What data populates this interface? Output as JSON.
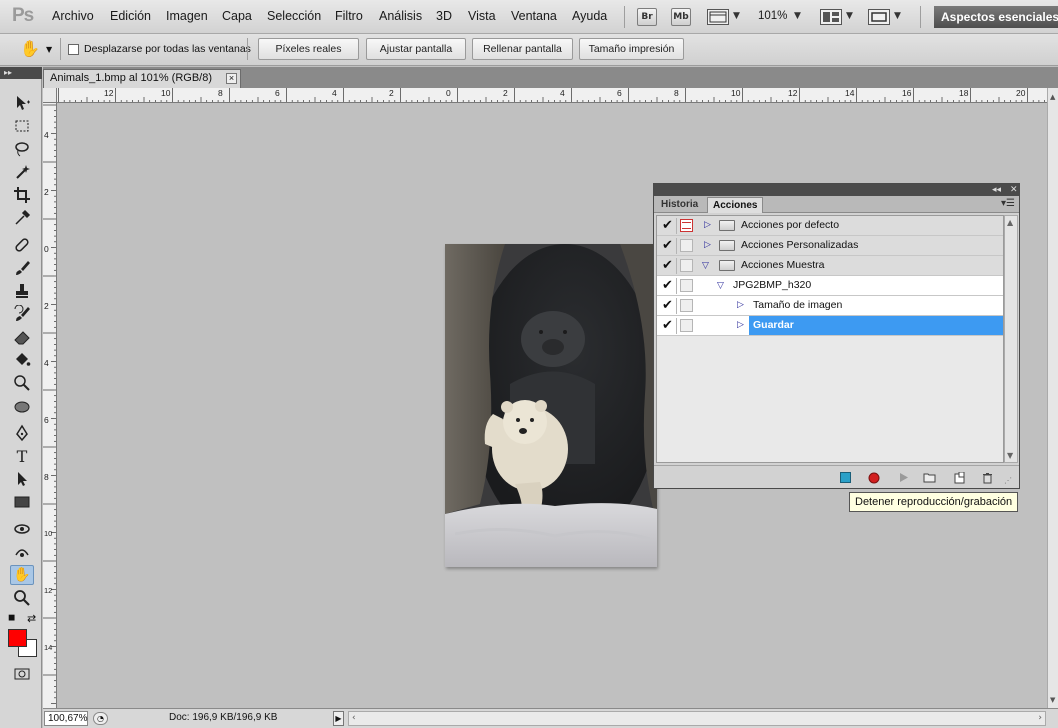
{
  "app": {
    "logo": "Ps"
  },
  "menu": {
    "items": [
      "Archivo",
      "Edición",
      "Imagen",
      "Capa",
      "Selección",
      "Filtro",
      "Análisis",
      "3D",
      "Vista",
      "Ventana",
      "Ayuda"
    ],
    "bridge_label": "Br",
    "minibridge_label": "Mb",
    "zoom": "101%",
    "workspace": "Aspectos esenciales"
  },
  "options": {
    "scroll_all_label": "Desplazarse por todas las ventanas",
    "scroll_all_checked": false,
    "buttons": [
      "Píxeles reales",
      "Ajustar pantalla",
      "Rellenar pantalla",
      "Tamaño impresión"
    ]
  },
  "document": {
    "tab_title": "Animals_1.bmp al 101% (RGB/8)",
    "ruler_top": [
      "12",
      "10",
      "8",
      "6",
      "4",
      "2",
      "0",
      "2",
      "4",
      "6",
      "8",
      "10",
      "12",
      "14",
      "16",
      "18",
      "20"
    ],
    "ruler_left": [
      "4",
      "2",
      "0",
      "2",
      "4",
      "6",
      "8",
      "10",
      "12",
      "14"
    ]
  },
  "status": {
    "zoom": "100,67%",
    "doc_info": "Doc: 196,9 KB/196,9 KB"
  },
  "actions_panel": {
    "tabs": [
      "Historia",
      "Acciones"
    ],
    "active_tab": "Acciones",
    "rows": [
      {
        "label": "Acciones por defecto",
        "kind": "set",
        "expanded": false,
        "checked": true,
        "dialog": "on"
      },
      {
        "label": "Acciones Personalizadas",
        "kind": "set",
        "expanded": false,
        "checked": true,
        "dialog": "off"
      },
      {
        "label": "Acciones Muestra",
        "kind": "set",
        "expanded": true,
        "checked": true,
        "dialog": "off"
      },
      {
        "label": "JPG2BMP_h320",
        "kind": "action",
        "expanded": true,
        "checked": true,
        "dialog": "off"
      },
      {
        "label": "Tamaño de imagen",
        "kind": "step",
        "expanded": false,
        "checked": true,
        "dialog": "off"
      },
      {
        "label": "Guardar",
        "kind": "step",
        "expanded": false,
        "checked": true,
        "dialog": "off",
        "selected": true
      }
    ],
    "footer_buttons": [
      "stop-icon",
      "record-icon",
      "play-icon",
      "new-set-icon",
      "new-action-icon",
      "delete-icon"
    ]
  },
  "tooltip": {
    "text": "Detener reproducción/grabación"
  },
  "colors": {
    "foreground": "#ff0000",
    "background": "#ffffff",
    "selection": "#3d9af2",
    "canvas": "#c0c0c0"
  }
}
